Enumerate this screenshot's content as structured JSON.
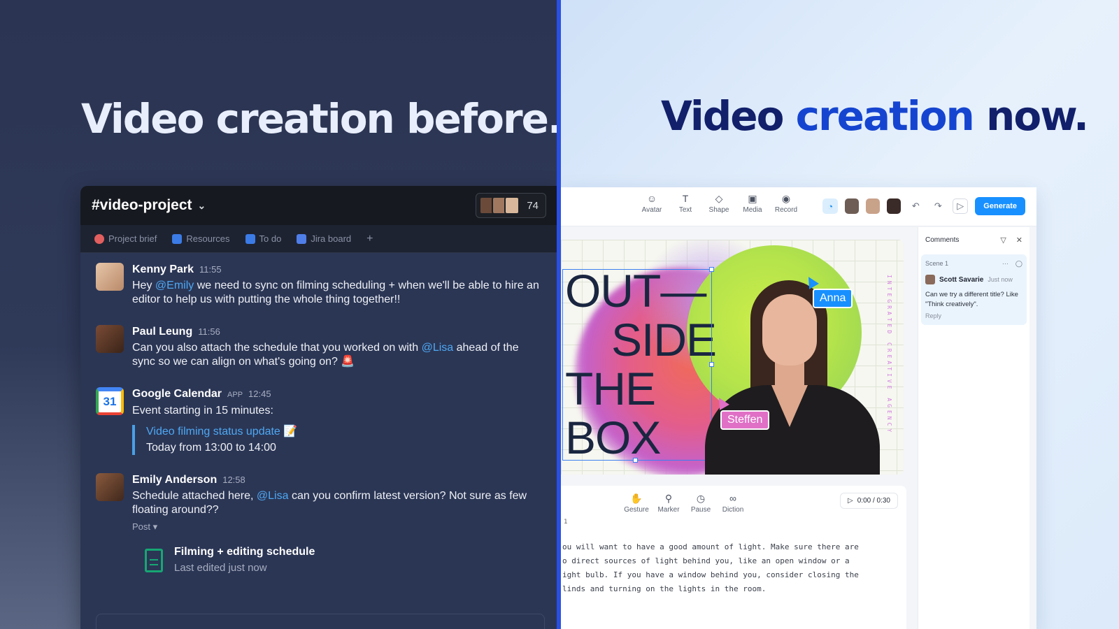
{
  "left": {
    "heading": "Video creation before...",
    "slack": {
      "channel": "#video-project",
      "member_count": "74",
      "tabs": [
        {
          "label": "Project brief",
          "color": "#e25f5f"
        },
        {
          "label": "Resources",
          "color": "#3b7be6"
        },
        {
          "label": "To do",
          "color": "#3b7be6"
        },
        {
          "label": "Jira board",
          "color": "#4f7ee8"
        },
        {
          "label": "+"
        }
      ],
      "messages": [
        {
          "name": "Kenny Park",
          "time": "11:55",
          "before": "Hey ",
          "mention": "@Emily",
          "after": " we need to sync on filming scheduling + when we'll be able to hire an editor to help us with putting the whole thing together!!"
        },
        {
          "name": "Paul Leung",
          "time": "11:56",
          "before": "Can you also attach the schedule that you worked on with ",
          "mention": "@Lisa",
          "after": " ahead of the sync so we can align on what's going on? 🚨"
        },
        {
          "name": "Emily Anderson",
          "time": "12:58",
          "before": "Schedule attached here, ",
          "mention": "@Lisa",
          "after": " can you confirm latest version? Not sure as few floating around??"
        }
      ],
      "calendar": {
        "name": "Google Calendar",
        "badge": "APP",
        "time": "12:45",
        "icon_day": "31",
        "text": "Event starting in 15 minutes:",
        "event_title": "Video filming status update 📝",
        "event_time": "Today from 13:00 to 14:00"
      },
      "post_label": "Post ▾",
      "file": {
        "name": "Filming + editing schedule",
        "sub": "Last edited just now"
      }
    }
  },
  "right": {
    "heading_part1": "Video creation",
    "heading_part2": " creation",
    "heading_part3": " now.",
    "tools": [
      {
        "label": "Avatar",
        "icon": "☺"
      },
      {
        "label": "Text",
        "icon": "T"
      },
      {
        "label": "Shape",
        "icon": "◇"
      },
      {
        "label": "Media",
        "icon": "▣"
      },
      {
        "label": "Record",
        "icon": "◉"
      }
    ],
    "generate_label": "Generate",
    "canvas_text": [
      "OUT—",
      "  SIDE",
      "THE",
      "BOX"
    ],
    "vertical_text": "INTEGRATED CREATIVE AGENCY",
    "cursor_anna": "Anna",
    "cursor_steffen": "Steffen",
    "script_tools": [
      {
        "label": "Gesture",
        "icon": "✋"
      },
      {
        "label": "Marker",
        "icon": "⚲"
      },
      {
        "label": "Pause",
        "icon": "◷"
      },
      {
        "label": "Diction",
        "icon": "∞"
      }
    ],
    "timecode": "0:00 / 0:30",
    "scene_number": "1",
    "script_lines": [
      "ou will want to have a good amount of light. Make sure there are",
      "o direct sources of light behind you, like an open window or a",
      "ight bulb. If you have a window behind you, consider closing the",
      "linds and turning on the lights in the room."
    ],
    "comments": {
      "title": "Comments",
      "scene": "Scene 1",
      "user": "Scott Savarie",
      "when": "Just now",
      "text": "Can we try a different title? Like \"Think creatively\".",
      "reply": "Reply"
    }
  }
}
